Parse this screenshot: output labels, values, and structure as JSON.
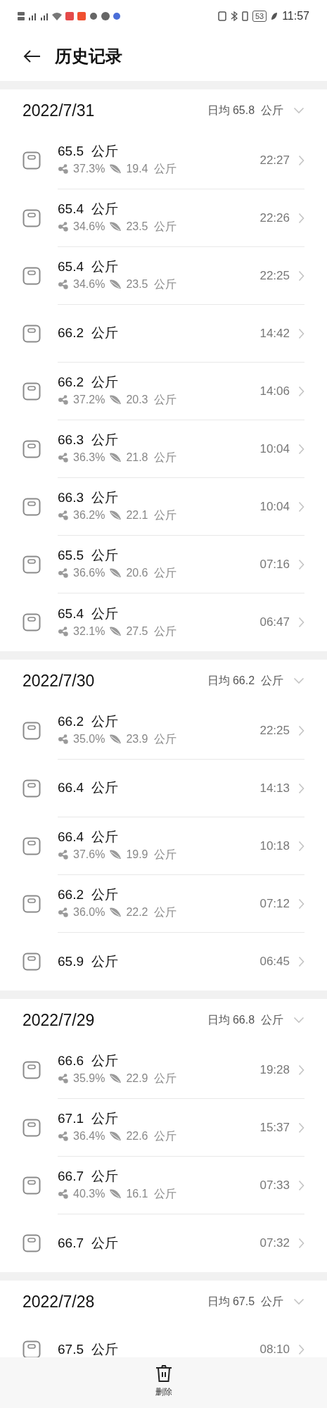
{
  "status_bar": {
    "battery": "53",
    "time": "11:57"
  },
  "header": {
    "title": "历史记录"
  },
  "groups": [
    {
      "date": "2022/7/31",
      "average": "日均 65.8  公斤",
      "records": [
        {
          "kind": "full",
          "weight": "65.5  公斤",
          "fat": "37.3%",
          "muscle": "19.4  公斤",
          "time": "22:27"
        },
        {
          "kind": "full",
          "weight": "65.4  公斤",
          "fat": "34.6%",
          "muscle": "23.5  公斤",
          "time": "22:26"
        },
        {
          "kind": "full",
          "weight": "65.4  公斤",
          "fat": "34.6%",
          "muscle": "23.5  公斤",
          "time": "22:25"
        },
        {
          "kind": "weight",
          "weight": "66.2  公斤",
          "time": "14:42"
        },
        {
          "kind": "full",
          "weight": "66.2  公斤",
          "fat": "37.2%",
          "muscle": "20.3  公斤",
          "time": "14:06"
        },
        {
          "kind": "full",
          "weight": "66.3  公斤",
          "fat": "36.3%",
          "muscle": "21.8  公斤",
          "time": "10:04"
        },
        {
          "kind": "full",
          "weight": "66.3  公斤",
          "fat": "36.2%",
          "muscle": "22.1  公斤",
          "time": "10:04"
        },
        {
          "kind": "full",
          "weight": "65.5  公斤",
          "fat": "36.6%",
          "muscle": "20.6  公斤",
          "time": "07:16"
        },
        {
          "kind": "full",
          "weight": "65.4  公斤",
          "fat": "32.1%",
          "muscle": "27.5  公斤",
          "time": "06:47"
        }
      ]
    },
    {
      "date": "2022/7/30",
      "average": "日均 66.2  公斤",
      "records": [
        {
          "kind": "full",
          "weight": "66.2  公斤",
          "fat": "35.0%",
          "muscle": "23.9  公斤",
          "time": "22:25"
        },
        {
          "kind": "weight",
          "weight": "66.4  公斤",
          "time": "14:13"
        },
        {
          "kind": "full",
          "weight": "66.4  公斤",
          "fat": "37.6%",
          "muscle": "19.9  公斤",
          "time": "10:18"
        },
        {
          "kind": "full",
          "weight": "66.2  公斤",
          "fat": "36.0%",
          "muscle": "22.2  公斤",
          "time": "07:12"
        },
        {
          "kind": "weight",
          "weight": "65.9  公斤",
          "time": "06:45"
        }
      ]
    },
    {
      "date": "2022/7/29",
      "average": "日均 66.8  公斤",
      "records": [
        {
          "kind": "full",
          "weight": "66.6  公斤",
          "fat": "35.9%",
          "muscle": "22.9  公斤",
          "time": "19:28"
        },
        {
          "kind": "full",
          "weight": "67.1  公斤",
          "fat": "36.4%",
          "muscle": "22.6  公斤",
          "time": "15:37"
        },
        {
          "kind": "full",
          "weight": "66.7  公斤",
          "fat": "40.3%",
          "muscle": "16.1  公斤",
          "time": "07:33"
        },
        {
          "kind": "weight",
          "weight": "66.7  公斤",
          "time": "07:32"
        }
      ]
    },
    {
      "date": "2022/7/28",
      "average": "日均 67.5  公斤",
      "records": [
        {
          "kind": "weight",
          "weight": "67.5  公斤",
          "time": "08:10"
        }
      ]
    }
  ],
  "bottom_bar": {
    "delete": "删除"
  }
}
